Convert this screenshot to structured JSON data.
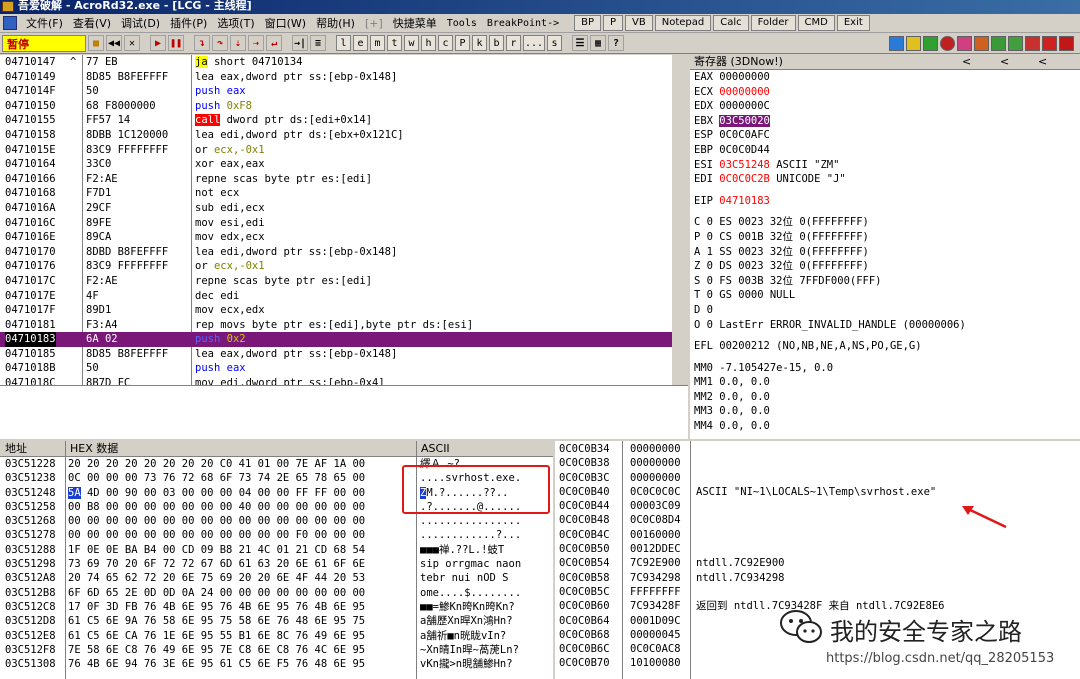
{
  "window": {
    "title": "吾爱破解 - AcroRd32.exe - [LCG - 主线程]"
  },
  "menu": {
    "items": [
      "文件(F)",
      "查看(V)",
      "调试(D)",
      "插件(P)",
      "选项(T)",
      "窗口(W)",
      "帮助(H)",
      "[+]",
      "快捷菜单",
      "Tools",
      "BreakPoint->"
    ],
    "buttons": [
      "BP",
      "P",
      "VB",
      "Notepad",
      "Calc",
      "Folder",
      "CMD",
      "Exit"
    ]
  },
  "toolbar": {
    "status": "暂停",
    "letters": [
      "l",
      "e",
      "m",
      "t",
      "w",
      "h",
      "c",
      "P",
      "k",
      "b",
      "r",
      "...",
      "s"
    ]
  },
  "disasm": {
    "rows": [
      {
        "addr": "04710147",
        "mark": "^",
        "hex": "77 EB",
        "op": "ja",
        "args": "short 04710134",
        "kind": "jmp"
      },
      {
        "addr": "04710149",
        "mark": "",
        "hex": "8D85 B8FEFFFF",
        "op": "lea",
        "args": "eax,dword ptr ss:[ebp-0x148]",
        "kind": ""
      },
      {
        "addr": "0471014F",
        "mark": "",
        "hex": "50",
        "op": "push",
        "args": "eax",
        "kind": "push"
      },
      {
        "addr": "04710150",
        "mark": "",
        "hex": "68 F8000000",
        "op": "push",
        "args": "0xF8",
        "kind": "pushimm"
      },
      {
        "addr": "04710155",
        "mark": "",
        "hex": "FF57 14",
        "op": "call",
        "args": "dword ptr ds:[edi+0x14]",
        "kind": "call"
      },
      {
        "addr": "04710158",
        "mark": "",
        "hex": "8DBB 1C120000",
        "op": "lea",
        "args": "edi,dword ptr ds:[ebx+0x121C]",
        "kind": ""
      },
      {
        "addr": "0471015E",
        "mark": "",
        "hex": "83C9 FFFFFFFF",
        "op": "or",
        "args": "ecx,-0x1",
        "kind": "neg"
      },
      {
        "addr": "04710164",
        "mark": "",
        "hex": "33C0",
        "op": "xor",
        "args": "eax,eax",
        "kind": ""
      },
      {
        "addr": "04710166",
        "mark": "",
        "hex": "F2:AE",
        "op": "repne",
        "args": "scas byte ptr es:[edi]",
        "kind": ""
      },
      {
        "addr": "04710168",
        "mark": "",
        "hex": "F7D1",
        "op": "not",
        "args": "ecx",
        "kind": ""
      },
      {
        "addr": "0471016A",
        "mark": "",
        "hex": "29CF",
        "op": "sub",
        "args": "edi,ecx",
        "kind": ""
      },
      {
        "addr": "0471016C",
        "mark": "",
        "hex": "89FE",
        "op": "mov",
        "args": "esi,edi",
        "kind": ""
      },
      {
        "addr": "0471016E",
        "mark": "",
        "hex": "89CA",
        "op": "mov",
        "args": "edx,ecx",
        "kind": ""
      },
      {
        "addr": "04710170",
        "mark": "",
        "hex": "8DBD B8FEFFFF",
        "op": "lea",
        "args": "edi,dword ptr ss:[ebp-0x148]",
        "kind": ""
      },
      {
        "addr": "04710176",
        "mark": "",
        "hex": "83C9 FFFFFFFF",
        "op": "or",
        "args": "ecx,-0x1",
        "kind": "neg"
      },
      {
        "addr": "0471017C",
        "mark": "",
        "hex": "F2:AE",
        "op": "repne",
        "args": "scas byte ptr es:[edi]",
        "kind": ""
      },
      {
        "addr": "0471017E",
        "mark": "",
        "hex": "4F",
        "op": "dec",
        "args": "edi",
        "kind": ""
      },
      {
        "addr": "0471017F",
        "mark": "",
        "hex": "89D1",
        "op": "mov",
        "args": "ecx,edx",
        "kind": ""
      },
      {
        "addr": "04710181",
        "mark": "",
        "hex": "F3:A4",
        "op": "rep movs",
        "args": "byte ptr es:[edi],byte ptr ds:[esi]",
        "kind": ""
      },
      {
        "addr": "04710183",
        "mark": "",
        "hex": "6A 02",
        "op": "push",
        "args": "0x2",
        "kind": "sel"
      },
      {
        "addr": "04710185",
        "mark": "",
        "hex": "8D85 B8FEFFFF",
        "op": "lea",
        "args": "eax,dword ptr ss:[ebp-0x148]",
        "kind": ""
      },
      {
        "addr": "0471018B",
        "mark": "",
        "hex": "50",
        "op": "push",
        "args": "eax",
        "kind": "push"
      },
      {
        "addr": "0471018C",
        "mark": "",
        "hex": "8B7D FC",
        "op": "mov",
        "args": "edi,dword ptr ss:[ebp-0x4]",
        "kind": ""
      }
    ]
  },
  "registers": {
    "title": "寄存器 (3DNow!)",
    "rows": [
      {
        "t": "EAX 00000000",
        "red": "",
        "tail": ""
      },
      {
        "t": "ECX ",
        "red": "00000000",
        "tail": ""
      },
      {
        "t": "EDX 0000000C",
        "red": "",
        "tail": ""
      },
      {
        "t": "EBX ",
        "red": "03C50020",
        "tail": "",
        "hl": true
      },
      {
        "t": "ESP 0C0C0AFC",
        "red": "",
        "tail": ""
      },
      {
        "t": "EBP 0C0C0D44",
        "red": "",
        "tail": ""
      },
      {
        "t": "ESI ",
        "red": "03C51248",
        "tail": " ASCII \"ZM\""
      },
      {
        "t": "EDI ",
        "red": "0C0C0C2B",
        "tail": " UNICODE \"J\""
      },
      {
        "gap": true
      },
      {
        "t": "EIP ",
        "red": "04710183",
        "tail": ""
      },
      {
        "gap": true
      },
      {
        "t": "C 0  ES 0023 32位 0(FFFFFFFF)",
        "red": "",
        "tail": ""
      },
      {
        "t": "P 0  CS 001B 32位 0(FFFFFFFF)",
        "red": "",
        "tail": ""
      },
      {
        "t": "A 1  SS 0023 32位 0(FFFFFFFF)",
        "red": "",
        "tail": ""
      },
      {
        "t": "Z 0  DS 0023 32位 0(FFFFFFFF)",
        "red": "",
        "tail": ""
      },
      {
        "t": "S 0  FS 003B 32位 7FFDF000(FFF)",
        "red": "",
        "tail": ""
      },
      {
        "t": "T 0  GS 0000 NULL",
        "red": "",
        "tail": ""
      },
      {
        "t": "D 0",
        "red": "",
        "tail": ""
      },
      {
        "t": "O 0  LastErr ERROR_INVALID_HANDLE (00000006)",
        "red": "",
        "tail": ""
      },
      {
        "gap": true
      },
      {
        "t": "EFL 00200212 (NO,NB,NE,A,NS,PO,GE,G)",
        "red": "",
        "tail": ""
      },
      {
        "gap": true
      },
      {
        "t": "MM0 -7.105427e-15,          0.0",
        "red": "",
        "tail": ""
      },
      {
        "t": "MM1           0.0,          0.0",
        "red": "",
        "tail": ""
      },
      {
        "t": "MM2           0.0,          0.0",
        "red": "",
        "tail": ""
      },
      {
        "t": "MM3           0.0,          0.0",
        "red": "",
        "tail": ""
      },
      {
        "t": "MM4           0.0,          0.0",
        "red": "",
        "tail": ""
      }
    ]
  },
  "dump": {
    "col_addr": "地址",
    "col_hex": "HEX 数据",
    "col_ascii": "ASCII",
    "rows": [
      {
        "a": "03C51228",
        "h": "20 20 20 20 20 20 20 20 C0 41 01 00 7E AF 1A 00",
        "s": "        繹Ａ.~?."
      },
      {
        "a": "03C51238",
        "h": "0C 00 00 00 73 76 72 68 6F 73 74 2E 65 78 65 00",
        "s": "....svrhost.exe."
      },
      {
        "a": "03C51248",
        "h": "5A 4D 00 90 00 03 00 00 00 04 00 00 FF FF 00 00",
        "s": "ZM.?......??..",
        "hb": true
      },
      {
        "a": "03C51258",
        "h": "00 B8 00 00 00 00 00 00 00 40 00 00 00 00 00 00",
        "s": ".?.......@......"
      },
      {
        "a": "03C51268",
        "h": "00 00 00 00 00 00 00 00 00 00 00 00 00 00 00 00",
        "s": "................"
      },
      {
        "a": "03C51278",
        "h": "00 00 00 00 00 00 00 00 00 00 00 00 F0 00 00 00",
        "s": "............?..."
      },
      {
        "a": "03C51288",
        "h": "1F 0E 0E BA B4 00 CD 09 B8 21 4C 01 21 CD 68 54",
        "s": "■■■禅.??L.!蚑T"
      },
      {
        "a": "03C51298",
        "h": "73 69 70 20 6F 72 72 67 6D 61 63 20 6E 61 6F 6E",
        "s": "sip orrgmac naon"
      },
      {
        "a": "03C512A8",
        "h": "20 74 65 62 72 20 6E 75 69 20 20 6E 4F 44 20 53",
        "s": " tebr nui  nOD S"
      },
      {
        "a": "03C512B8",
        "h": "6F 6D 65 2E 0D 0D 0A 24 00 00 00 00 00 00 00 00",
        "s": "ome....$........"
      },
      {
        "a": "03C512C8",
        "h": "17 0F 3D FB 76 4B 6E 95 76 4B 6E 95 76 4B 6E 95",
        "s": "■■=鯵Kn晇Kn晇Kn?"
      },
      {
        "a": "03C512D8",
        "h": "61 C5 6E 9A 76 58 6E 95 75 58 6E 76 48 6E 95 75",
        "s": "a舗歷Xn晘Xn鴻Hn?"
      },
      {
        "a": "03C512E8",
        "h": "61 C5 6E CA 76 1E 6E 95 55 B1 6E 8C 76 49 6E 95",
        "s": "a舗祈■n晄眬vIn?"
      },
      {
        "a": "03C512F8",
        "h": "7E 58 6E C8 76 49 6E 95 7E C8 6E C8 76 4C 6E 95",
        "s": "~Xn晴In晘~萵萀Ln?"
      },
      {
        "a": "03C51308",
        "h": "76 4B 6E 94 76 3E 6E 95 61 C5 6E F5 76 48 6E 95",
        "s": "vKn攏>n晛舗鯵Hn?"
      }
    ]
  },
  "stack": {
    "rows": [
      {
        "a": "0C0C0B34",
        "v": "00000000",
        "c": ""
      },
      {
        "a": "0C0C0B38",
        "v": "00000000",
        "c": ""
      },
      {
        "a": "0C0C0B3C",
        "v": "00000000",
        "c": ""
      },
      {
        "a": "0C0C0B40",
        "v": "0C0C0C0C",
        "c": "ASCII \"NI~1\\LOCALS~1\\Temp\\svrhost.exe\""
      },
      {
        "a": "0C0C0B44",
        "v": "00003C09",
        "c": ""
      },
      {
        "a": "0C0C0B48",
        "v": "0C0C08D4",
        "c": ""
      },
      {
        "a": "0C0C0B4C",
        "v": "00160000",
        "c": ""
      },
      {
        "a": "0C0C0B50",
        "v": "0012DDEC",
        "c": ""
      },
      {
        "a": "0C0C0B54",
        "v": "7C92E900",
        "c": "ntdll.7C92E900"
      },
      {
        "a": "0C0C0B58",
        "v": "7C934298",
        "c": "ntdll.7C934298"
      },
      {
        "a": "0C0C0B5C",
        "v": "FFFFFFFF",
        "c": ""
      },
      {
        "a": "0C0C0B60",
        "v": "7C93428F",
        "c": "返回到 ntdll.7C93428F 来自 ntdll.7C92E8E6"
      },
      {
        "a": "0C0C0B64",
        "v": "0001D09C",
        "c": ""
      },
      {
        "a": "0C0C0B68",
        "v": "00000045",
        "c": ""
      },
      {
        "a": "0C0C0B6C",
        "v": "0C0C0AC8",
        "c": ""
      },
      {
        "a": "0C0C0B70",
        "v": "10100080",
        "c": ""
      }
    ]
  },
  "watermark": {
    "title": "我的安全专家之路",
    "url": "https://blog.csdn.net/qq_28205153"
  },
  "colors": {
    "selection": "#7a187a",
    "changed": "#ff0000",
    "pause_bg": "#ffff00",
    "annotation": "#e01818"
  }
}
